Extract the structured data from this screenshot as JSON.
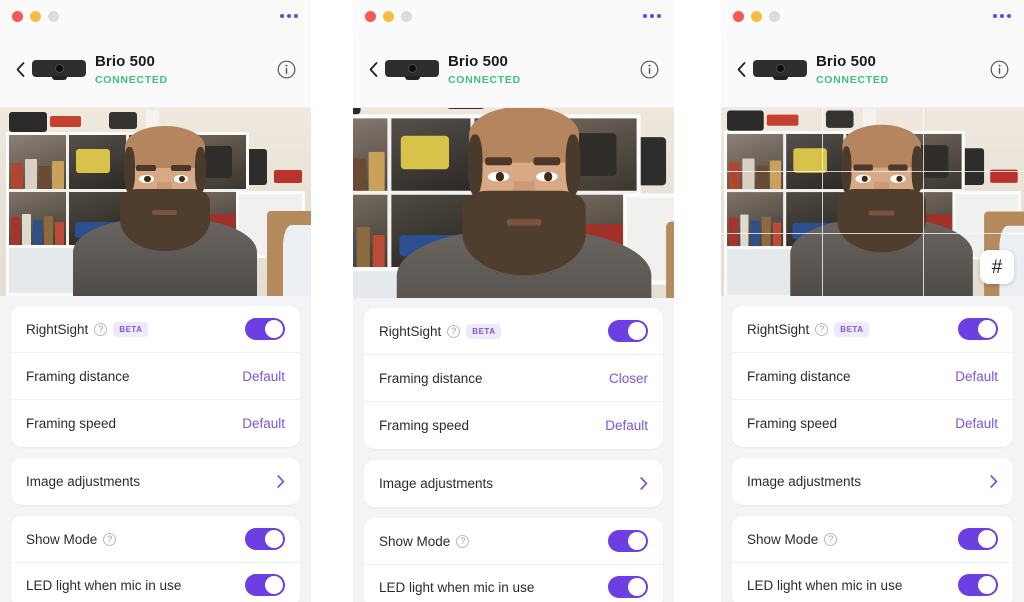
{
  "app": {
    "window_controls": [
      "close",
      "minimize",
      "maximize"
    ],
    "overflow_menu": "•••",
    "accent_color": "#6d3fe3",
    "value_color": "#7b55e0",
    "status_color": "#3ec17b"
  },
  "device": {
    "back_icon": "chevron-left-icon",
    "thumbnail_icon": "webcam-icon",
    "name": "Brio 500",
    "status": "CONNECTED",
    "info_icon": "info-icon"
  },
  "preview": {
    "grid_button_glyph": "#",
    "grid_button_name": "grid-overlay-toggle"
  },
  "settings": {
    "rightsight_label": "RightSight",
    "beta_badge": "BETA",
    "framing_distance_label": "Framing distance",
    "framing_speed_label": "Framing speed",
    "image_adjustments_label": "Image adjustments",
    "show_mode_label": "Show Mode",
    "led_label": "LED light when mic in use",
    "value_default": "Default",
    "value_closer": "Closer",
    "help_glyph": "?"
  },
  "panels": [
    {
      "id": "panel-left",
      "framing_distance_value": "Default",
      "framing_speed_value": "Default",
      "grid_overlay_visible": false,
      "grid_button_visible": false,
      "rightsight_on": true,
      "show_mode_on": true,
      "led_on": true
    },
    {
      "id": "panel-middle",
      "framing_distance_value": "Closer",
      "framing_speed_value": "Default",
      "grid_overlay_visible": false,
      "grid_button_visible": false,
      "rightsight_on": true,
      "show_mode_on": true,
      "led_on": true
    },
    {
      "id": "panel-right",
      "framing_distance_value": "Default",
      "framing_speed_value": "Default",
      "grid_overlay_visible": true,
      "grid_button_visible": true,
      "rightsight_on": true,
      "show_mode_on": true,
      "led_on": true
    }
  ]
}
